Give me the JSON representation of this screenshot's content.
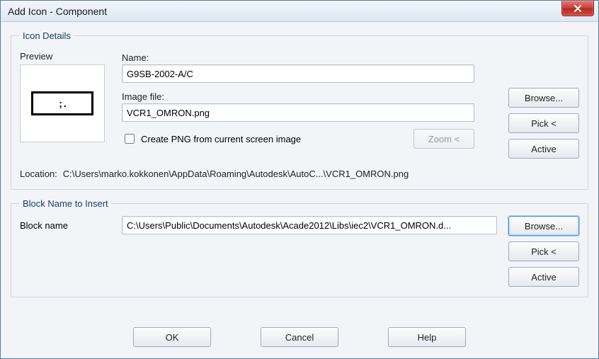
{
  "window": {
    "title": "Add Icon - Component"
  },
  "iconDetails": {
    "legend": "Icon Details",
    "previewLabel": "Preview",
    "previewGlyph": "; .",
    "nameLabel": "Name:",
    "nameValue": "G9SB-2002-A/C",
    "imageLabel": "Image file:",
    "imageValue": "VCR1_OMRON.png",
    "createPngLabel": "Create PNG from current screen image",
    "zoomLabel": "Zoom <",
    "browseLabel": "Browse...",
    "pickLabel": "Pick <",
    "activeLabel": "Active",
    "locationLabel": "Location:",
    "locationValue": "C:\\Users\\marko.kokkonen\\AppData\\Roaming\\Autodesk\\AutoC...\\VCR1_OMRON.png"
  },
  "blockName": {
    "legend": "Block Name to Insert",
    "label": "Block name",
    "value": "C:\\Users\\Public\\Documents\\Autodesk\\Acade2012\\Libs\\iec2\\VCR1_OMRON.d...",
    "browseLabel": "Browse...",
    "pickLabel": "Pick <",
    "activeLabel": "Active"
  },
  "footer": {
    "ok": "OK",
    "cancel": "Cancel",
    "help": "Help"
  }
}
